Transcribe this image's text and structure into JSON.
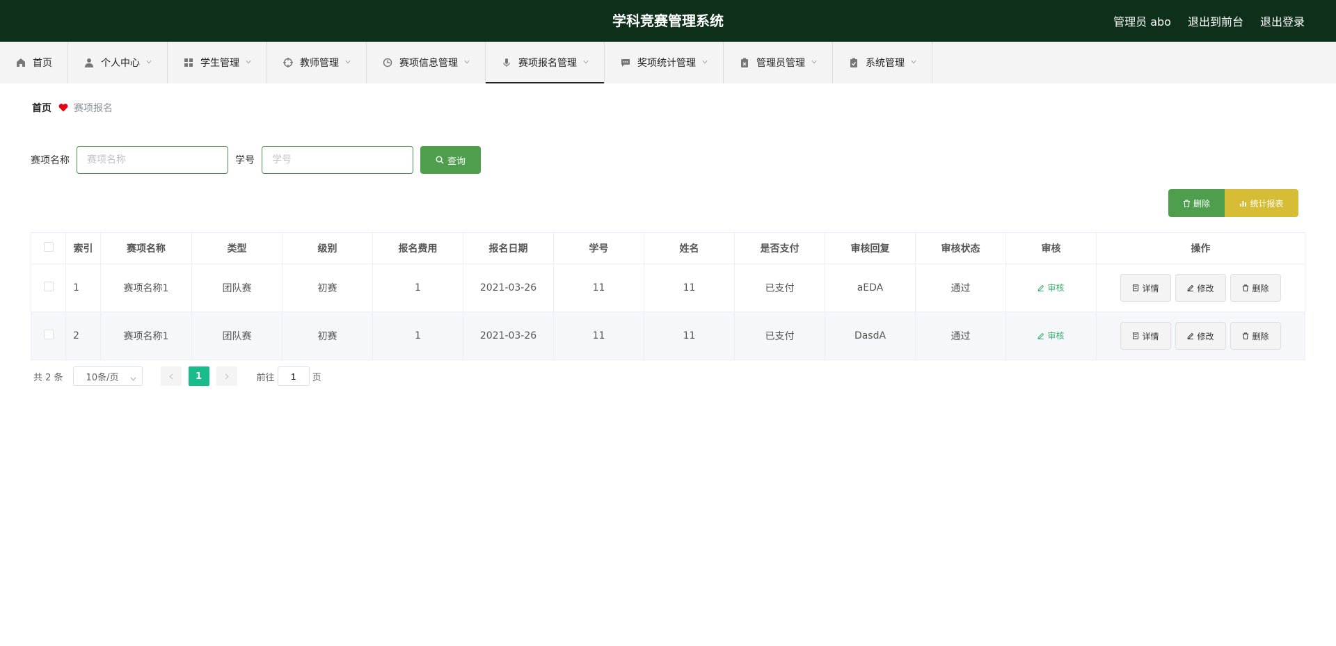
{
  "header": {
    "title": "学科竞赛管理系统",
    "links": [
      "管理员 abo",
      "退出到前台",
      "退出登录"
    ]
  },
  "nav": {
    "items": [
      {
        "label": "首页",
        "icon": "home-icon"
      },
      {
        "label": "个人中心",
        "icon": "user-icon"
      },
      {
        "label": "学生管理",
        "icon": "grid-icon"
      },
      {
        "label": "教师管理",
        "icon": "target-icon"
      },
      {
        "label": "赛项信息管理",
        "icon": "clock-icon"
      },
      {
        "label": "赛项报名管理",
        "icon": "mic-icon"
      },
      {
        "label": "奖项统计管理",
        "icon": "chat-icon"
      },
      {
        "label": "管理员管理",
        "icon": "clipboard-x-icon"
      },
      {
        "label": "系统管理",
        "icon": "clipboard-check-icon"
      }
    ],
    "active_index": 5
  },
  "breadcrumb": {
    "home": "首页",
    "current": "赛项报名"
  },
  "search": {
    "name_label": "赛项名称",
    "name_placeholder": "赛项名称",
    "id_label": "学号",
    "id_placeholder": "学号",
    "query_label": "查询"
  },
  "actions": {
    "delete_label": "删除",
    "stats_label": "统计报表"
  },
  "table": {
    "headers": [
      "索引",
      "赛项名称",
      "类型",
      "级别",
      "报名费用",
      "报名日期",
      "学号",
      "姓名",
      "是否支付",
      "审核回复",
      "审核状态",
      "审核",
      "操作"
    ],
    "rows": [
      {
        "index": "1",
        "name": "赛项名称1",
        "type": "团队赛",
        "level": "初赛",
        "fee": "1",
        "date": "2021-03-26",
        "student_id": "11",
        "student_name": "11",
        "paid": "已支付",
        "reply": "aEDA",
        "status": "通过"
      },
      {
        "index": "2",
        "name": "赛项名称1",
        "type": "团队赛",
        "level": "初赛",
        "fee": "1",
        "date": "2021-03-26",
        "student_id": "11",
        "student_name": "11",
        "paid": "已支付",
        "reply": "DasdA",
        "status": "通过"
      }
    ],
    "audit_label": "审核",
    "detail_label": "详情",
    "edit_label": "修改",
    "delete_label": "删除"
  },
  "pagination": {
    "total": "共 2 条",
    "page_size": "10条/页",
    "current_page": "1",
    "goto_label": "前往",
    "goto_value": "1",
    "page_suffix": "页"
  },
  "colors": {
    "header_bg": "#0e2f1a",
    "primary_green": "#4e9e4e",
    "stats_yellow": "#d6bd35",
    "page_active": "#1abc8c",
    "heart": "#e60012"
  }
}
